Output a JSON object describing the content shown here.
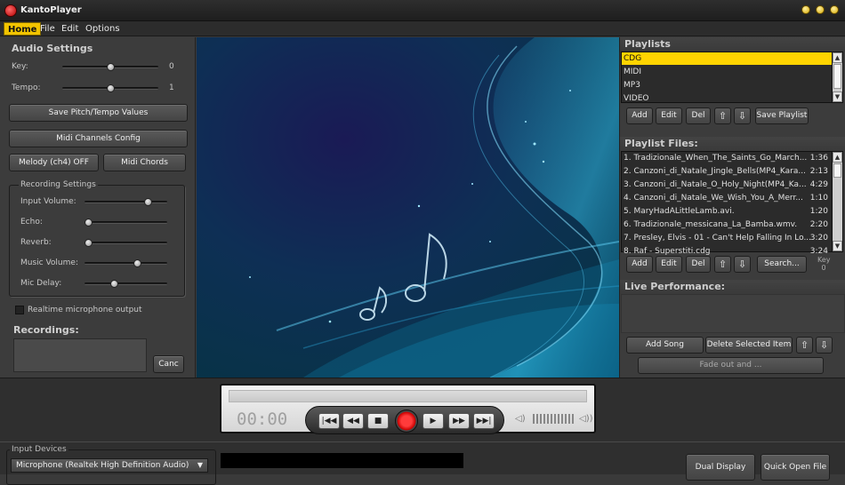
{
  "app": {
    "title": "KantoPlayer"
  },
  "menu": [
    "Home",
    "File",
    "Edit",
    "Options"
  ],
  "audio": {
    "title": "Audio Settings",
    "key_label": "Key:",
    "key_value": "0",
    "key_level": 0.5,
    "tempo_label": "Tempo:",
    "tempo_value": "1",
    "tempo_level": 0.5,
    "save_btn": "Save Pitch/Tempo Values",
    "midi_btn": "Midi Channels Config",
    "melody_btn": "Melody (ch4) OFF",
    "chords_btn": "Midi Chords"
  },
  "recording": {
    "title": "Recording Settings",
    "sliders": [
      {
        "label": "Input Volume:",
        "level": 0.8
      },
      {
        "label": "Echo:",
        "level": 0.0
      },
      {
        "label": "Reverb:",
        "level": 0.0
      },
      {
        "label": "Music Volume:",
        "level": 0.65
      },
      {
        "label": "Mic Delay:",
        "level": 0.35
      }
    ],
    "realtime_label": "Realtime microphone output",
    "recordings_title": "Recordings:",
    "cancel_btn": "Canc"
  },
  "playlists": {
    "title": "Playlists",
    "items": [
      "CDG",
      "MIDI",
      "MP3",
      "VIDEO"
    ],
    "selected": 0,
    "buttons": {
      "add": "Add",
      "edit": "Edit",
      "del": "Del",
      "save": "Save Playlist"
    }
  },
  "playlist_files": {
    "title": "Playlist Files:",
    "items": [
      {
        "name": "1. Tradizionale_When_The_Saints_Go_March...",
        "dur": "1:36"
      },
      {
        "name": "2. Canzoni_di_Natale_Jingle_Bells(MP4_Kara...",
        "dur": "2:13"
      },
      {
        "name": "3. Canzoni_di_Natale_O_Holy_Night(MP4_Ka...",
        "dur": "4:29"
      },
      {
        "name": "4. Canzoni_di_Natale_We_Wish_You_A_Merr...",
        "dur": "1:10"
      },
      {
        "name": "5. MaryHadALittleLamb.avi.",
        "dur": "1:20"
      },
      {
        "name": "6. Tradizionale_messicana_La_Bamba.wmv.",
        "dur": "2:20"
      },
      {
        "name": "7. Presley, Elvis - 01 - Can't Help Falling In Lo...",
        "dur": "3:20"
      },
      {
        "name": "8. Raf - Superstiti.cdg",
        "dur": "3:24"
      }
    ],
    "buttons": {
      "add": "Add",
      "edit": "Edit",
      "del": "Del",
      "search": "Search..."
    },
    "key_label": "Key",
    "key_value": "0"
  },
  "live": {
    "title": "Live Performance:",
    "add_song": "Add Song",
    "delete_selected": "Delete Selected Item",
    "fade": "Fade out and ..."
  },
  "player": {
    "time": "00:00",
    "progress": 0
  },
  "footer": {
    "input_devices": "Input Devices",
    "device": "Microphone (Realtek High Definition Audio)",
    "dual_display": "Dual Display",
    "quick_open": "Quick Open File"
  },
  "colors": {
    "accent": "#ffd400",
    "record": "#e00000"
  }
}
